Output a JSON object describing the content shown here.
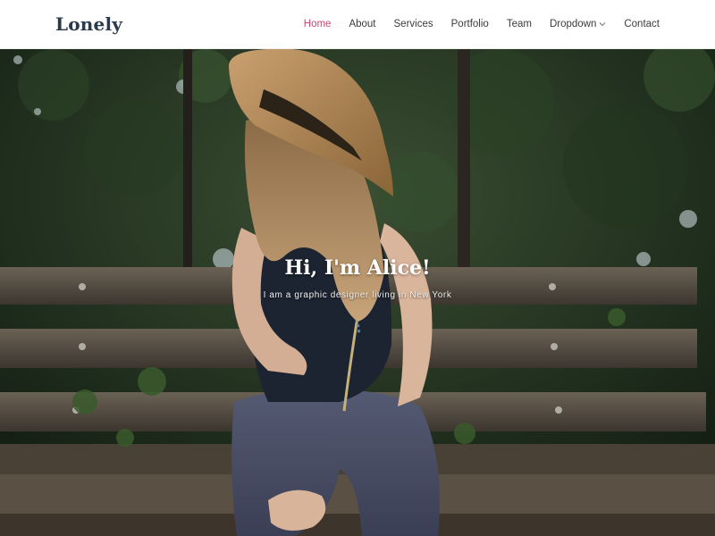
{
  "header": {
    "logo": "Lonely",
    "nav": [
      {
        "label": "Home",
        "active": true
      },
      {
        "label": "About",
        "active": false
      },
      {
        "label": "Services",
        "active": false
      },
      {
        "label": "Portfolio",
        "active": false
      },
      {
        "label": "Team",
        "active": false
      },
      {
        "label": "Dropdown",
        "active": false,
        "icon": "chevron-down-icon"
      },
      {
        "label": "Contact",
        "active": false
      }
    ]
  },
  "hero": {
    "title": "Hi, I'm Alice!",
    "subtitle": "I am a graphic designer living in New York",
    "image": "woman-in-straw-hat-on-park-bench"
  },
  "colors": {
    "accent": "#d44075",
    "logo": "#2b3a4a",
    "nav_text": "#3b3b3b"
  }
}
